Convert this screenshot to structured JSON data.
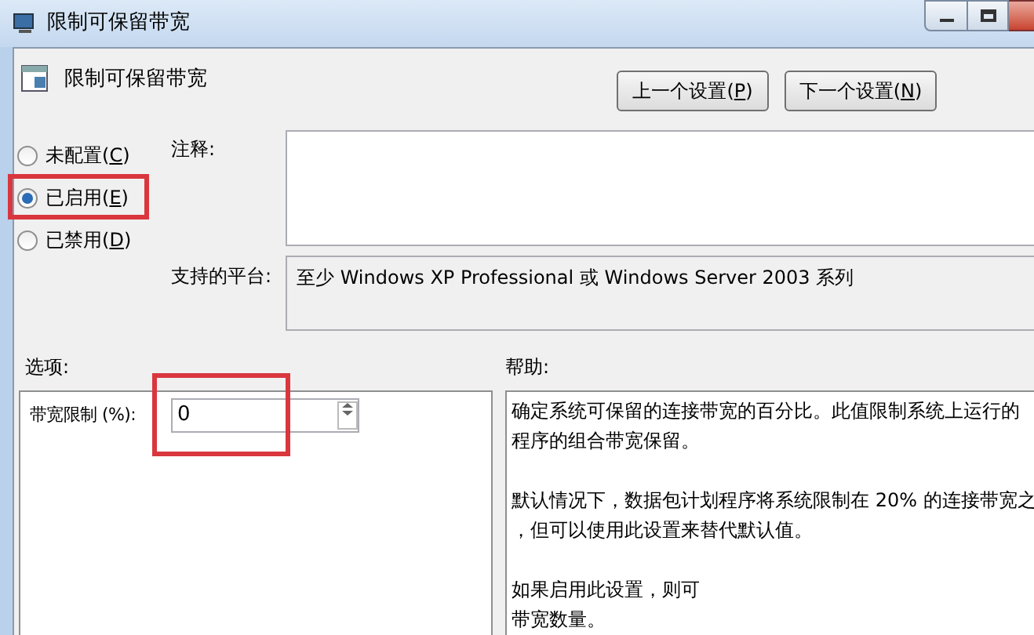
{
  "window": {
    "title": "限制可保留带宽"
  },
  "header": {
    "title": "限制可保留带宽",
    "buttons": [
      {
        "before": "上一个设置(",
        "key": "P",
        "after": ")"
      },
      {
        "before": "下一个设置(",
        "key": "N",
        "after": ")"
      }
    ]
  },
  "states": [
    {
      "before": "未配置(",
      "key": "C",
      "after": ")",
      "selected": false,
      "highlighted": false
    },
    {
      "before": "已启用(",
      "key": "E",
      "after": ")",
      "selected": true,
      "highlighted": true
    },
    {
      "before": "已禁用(",
      "key": "D",
      "after": ")",
      "selected": false,
      "highlighted": false
    }
  ],
  "comment": {
    "label": "注释:"
  },
  "platform": {
    "label": "支持的平台:",
    "value": "至少 Windows XP Professional 或 Windows Server 2003 系列"
  },
  "options": {
    "label": "选项:",
    "field_label": "带宽限制 (%):",
    "value": "0",
    "highlighted": true
  },
  "help": {
    "label": "帮助:",
    "paragraphs": [
      [
        "确定系统可保留的连接带宽的百分比。此值限制系统上运行的",
        "程序的组合带宽保留。"
      ],
      [
        "默认情况下，数据包计划程序将系统限制在 20% 的连接带宽之",
        "，但可以使用此设置来替代默认值。"
      ],
      [
        "如果启用此设置，则可",
        "带宽数量。"
      ]
    ]
  }
}
